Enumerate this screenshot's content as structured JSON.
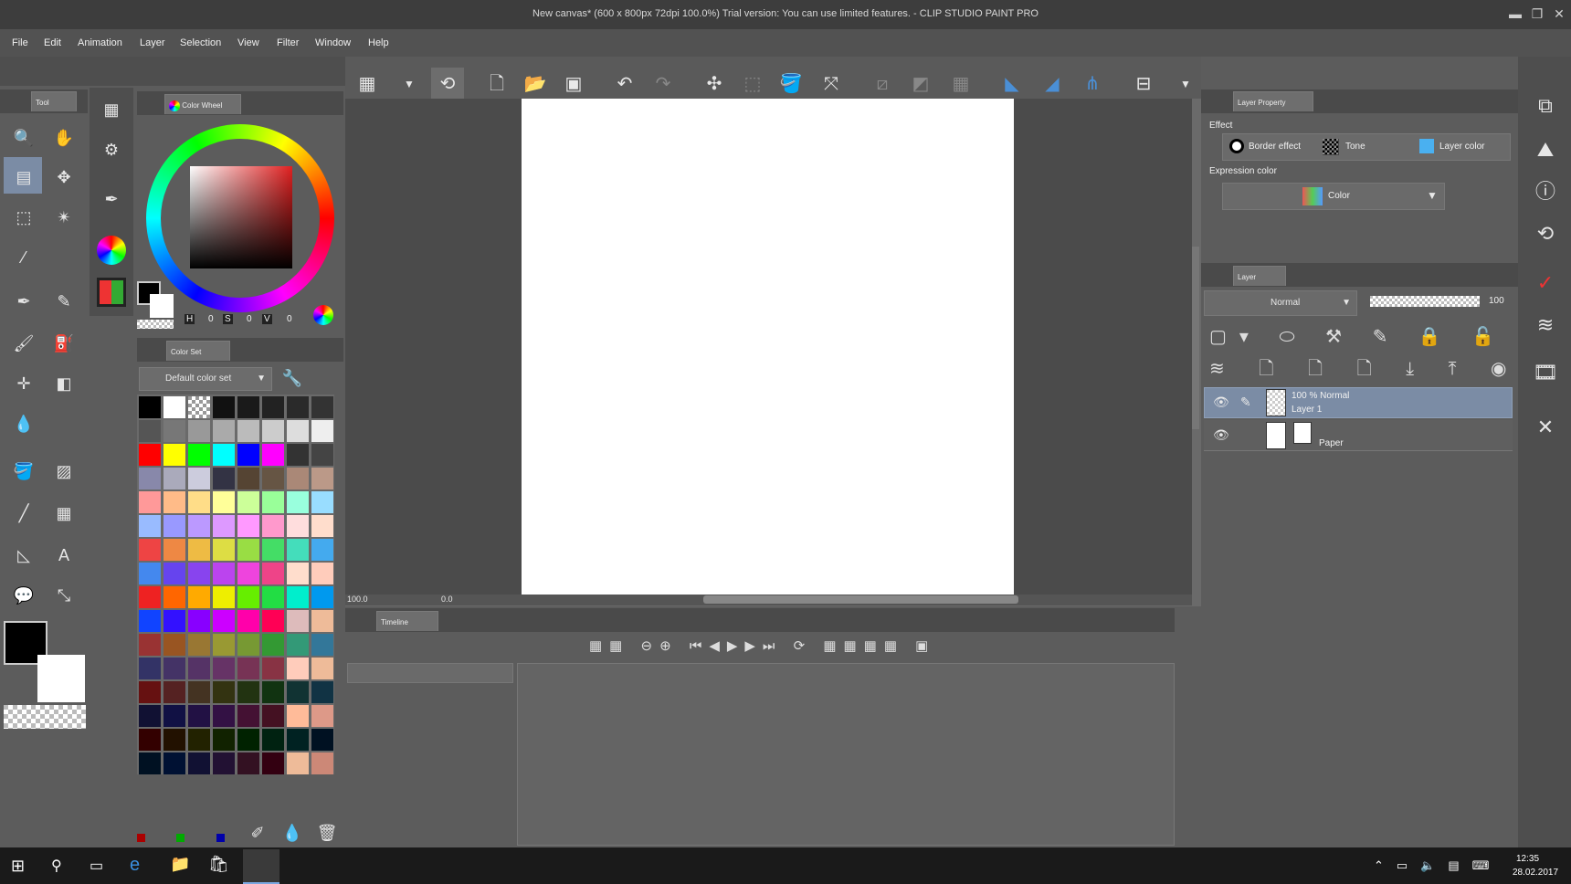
{
  "window": {
    "title": "New canvas* (600 x 800px 72dpi 100.0%)  Trial version: You can use limited features. - CLIP STUDIO PAINT PRO"
  },
  "menu": [
    "File",
    "Edit",
    "Animation",
    "Layer",
    "Selection",
    "View",
    "Filter",
    "Window",
    "Help"
  ],
  "tool_panel": {
    "tab": "Tool"
  },
  "color_wheel": {
    "tab": "Color Wheel",
    "h_label": "H",
    "h": "0",
    "s_label": "S",
    "s": "0",
    "v_label": "V",
    "v": "0"
  },
  "color_set": {
    "tab": "Color Set",
    "dropdown": "Default color set"
  },
  "canvas": {
    "zoom": "100.0",
    "rotation": "0.0"
  },
  "timeline": {
    "tab": "Timeline"
  },
  "layer_property": {
    "tab": "Layer Property",
    "effect_label": "Effect",
    "border_effect": "Border effect",
    "tone": "Tone",
    "layer_color": "Layer color",
    "expression_label": "Expression color",
    "expression_value": "Color"
  },
  "layer_panel": {
    "tab": "Layer",
    "blend_mode": "Normal",
    "opacity": "100",
    "layers": [
      {
        "info": "100 % Normal",
        "name": "Layer 1"
      },
      {
        "info": "",
        "name": "Paper"
      }
    ]
  },
  "taskbar": {
    "time": "12:35",
    "date": "28.02.2017"
  },
  "colors": {
    "accent": "#4a8fd6",
    "panel": "#5c5c5c",
    "canvas": "#ffffff"
  }
}
